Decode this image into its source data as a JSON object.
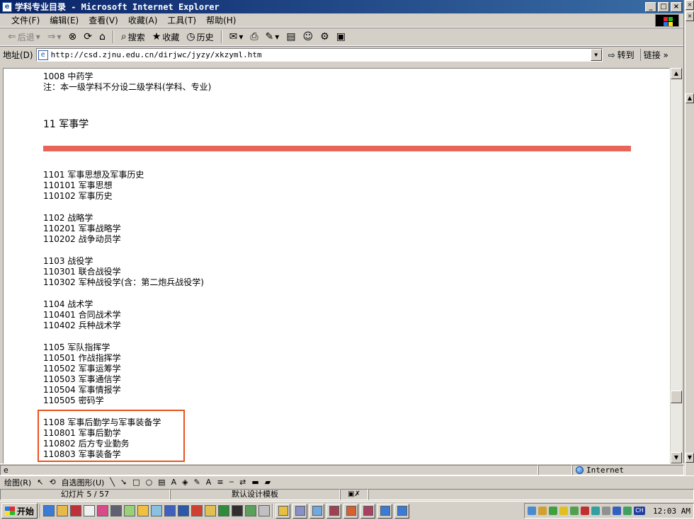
{
  "window": {
    "title": "学科专业目录 - Microsoft Internet Explorer",
    "controls": [
      "_",
      "□",
      "×"
    ]
  },
  "menu": [
    "文件(F)",
    "编辑(E)",
    "查看(V)",
    "收藏(A)",
    "工具(T)",
    "帮助(H)"
  ],
  "toolbar": {
    "back": "后退",
    "search": "搜索",
    "favorites": "收藏",
    "history": "历史"
  },
  "address": {
    "label": "地址(D)",
    "url": "http://csd.zjnu.edu.cn/dirjwc/jyzy/xkzyml.htm",
    "go": "转到",
    "links": "链接 »"
  },
  "content": {
    "top_lines": [
      "1008 中药学",
      "注：本一级学科不分设二级学科(学科、专业)"
    ],
    "section_title": "11 军事学",
    "groups": [
      [
        "1101 军事思想及军事历史",
        "110101 军事思想",
        "110102 军事历史"
      ],
      [
        "1102 战略学",
        "110201 军事战略学",
        "110202 战争动员学"
      ],
      [
        "1103 战役学",
        "110301 联合战役学",
        "110302 军种战役学(含：第二炮兵战役学)"
      ],
      [
        "1104 战术学",
        "110401 合同战术学",
        "110402 兵种战术学"
      ],
      [
        "1105 军队指挥学",
        "110501 作战指挥学",
        "110502 军事运筹学",
        "110503 军事通信学",
        "110504 军事情报学",
        "110505 密码学"
      ]
    ],
    "highlighted_group": [
      "1108 军事后勤学与军事装备学",
      "110801 军事后勤学",
      "110802 后方专业勤务",
      "110803 军事装备学"
    ],
    "accent_color": "#e8655a",
    "highlight_color": "#e8521e"
  },
  "status": {
    "zone": "Internet"
  },
  "ppt": {
    "draw_items": [
      "绘图(R)",
      "自选图形(U)"
    ],
    "slide_counter": "幻灯片 5 / 57",
    "template": "默认设计模板"
  },
  "taskbar": {
    "start": "开始",
    "clock": "12:03 AM",
    "tray_lang": "CH"
  }
}
